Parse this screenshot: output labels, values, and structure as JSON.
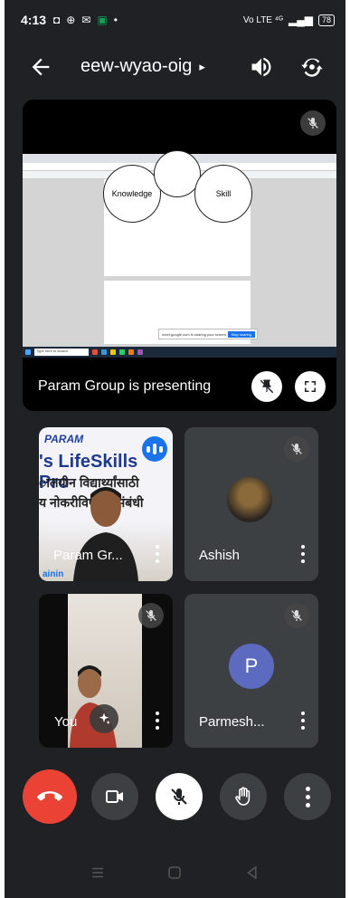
{
  "status_bar": {
    "time": "4:13",
    "network": "Vo LTE ⁴ᴳ",
    "battery": "78"
  },
  "header": {
    "meeting_code": "eew-wyao-oig",
    "chevron": "▸"
  },
  "presentation": {
    "label": "Param Group is presenting",
    "slide": {
      "circle_left": "Knowledge",
      "circle_right": "Skill",
      "share_bar_text": "meet.google.com is sharing your screen.",
      "stop_label": "Stop sharing",
      "taskbar_search": "Type here to search"
    }
  },
  "participants": [
    {
      "name": "Param Gr...",
      "speaking": true,
      "poster": {
        "brand": "PARAM",
        "line1": "'s LifeSkills Pro",
        "line2": "ालयीन विद्यार्थ्यांसाठी",
        "line3": "य नोकरीविषयक संबंधी",
        "line4": "ainin"
      }
    },
    {
      "name": "Ashish",
      "muted": true
    },
    {
      "name": "You",
      "muted": true
    },
    {
      "name": "Parmesh...",
      "initial": "P",
      "muted": true
    }
  ],
  "colors": {
    "background": "#202124",
    "tile": "#3c4043",
    "end_call": "#ea4335",
    "avatar": "#5c6bc0",
    "speaking": "#1a73e8"
  },
  "icons": {
    "back": "arrow-left",
    "speaker": "volume",
    "switch_camera": "camera-rotate",
    "end_call": "phone-hangup",
    "camera": "video-camera",
    "mic_off": "mic-off",
    "hand": "raise-hand",
    "more": "more-vertical"
  }
}
